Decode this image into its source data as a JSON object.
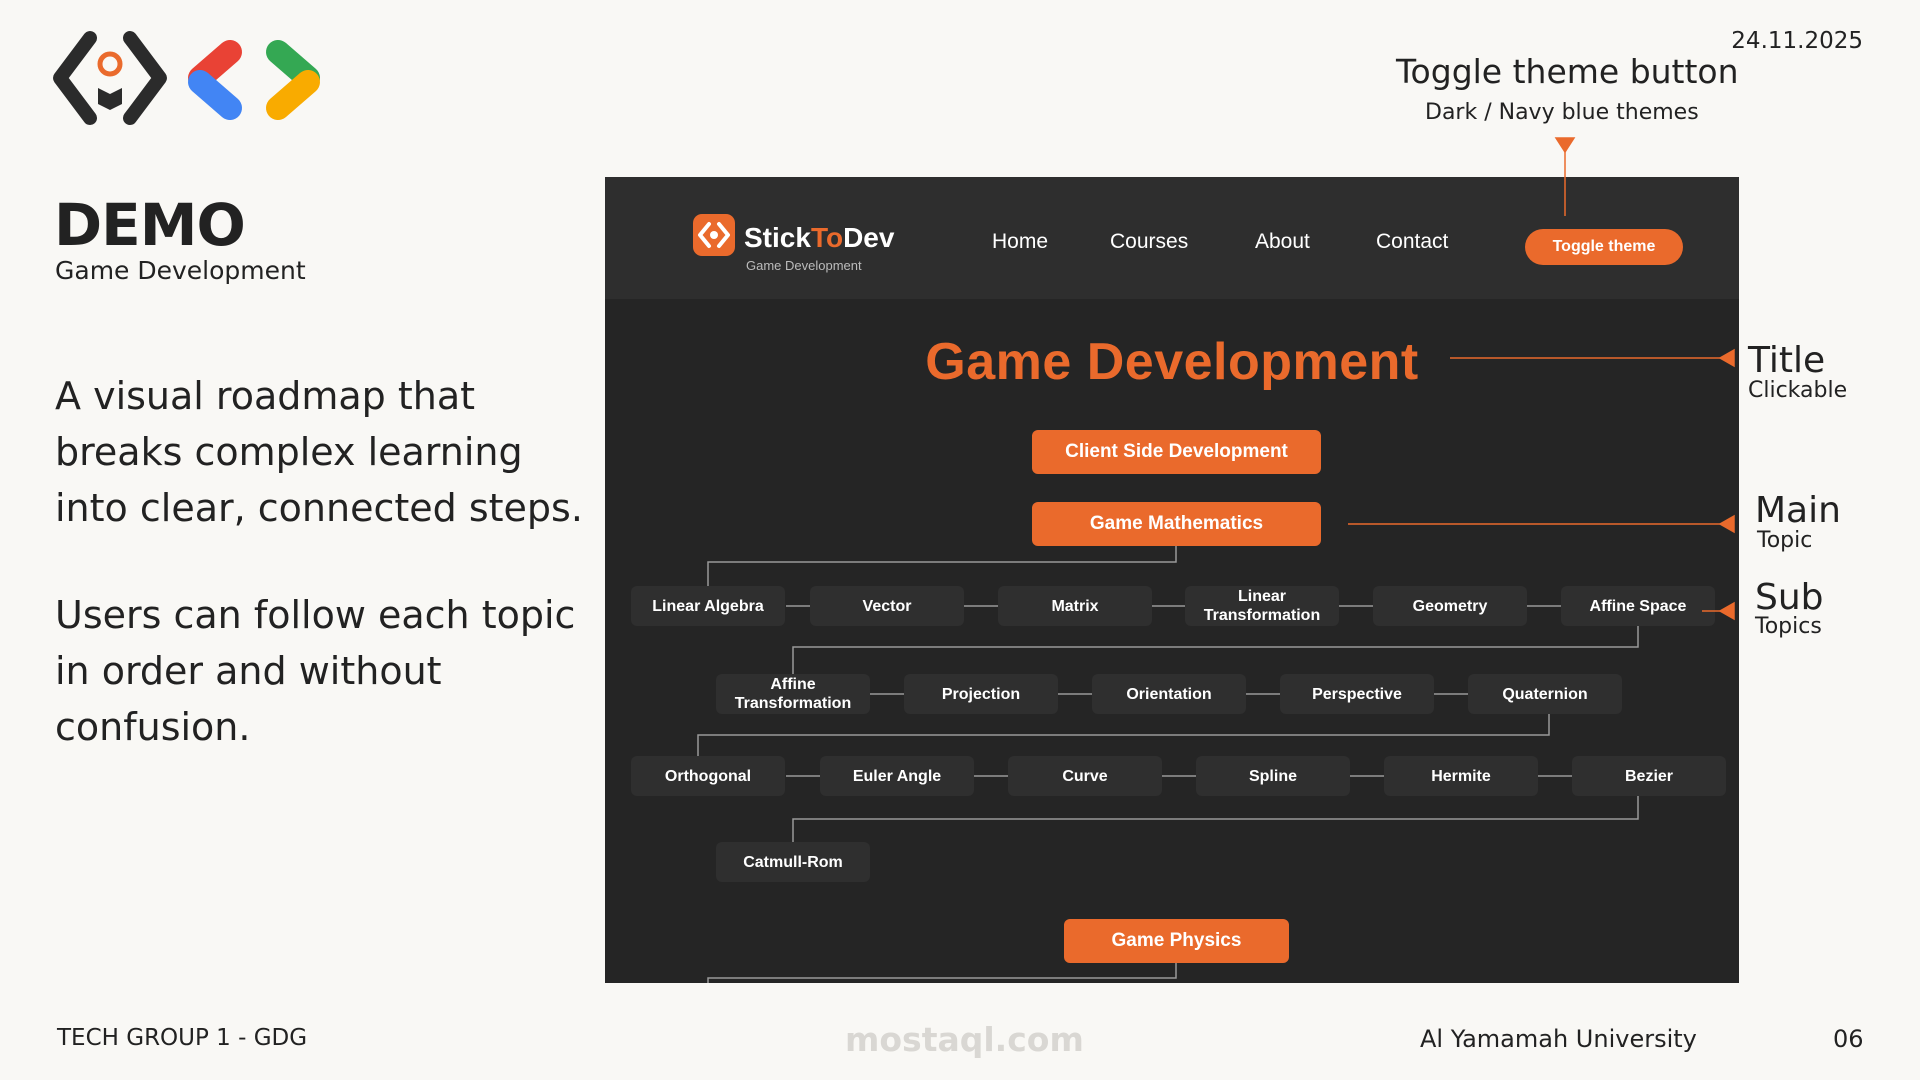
{
  "slide": {
    "date": "24.11.2025",
    "heading": "DEMO",
    "subheading": "Game Development",
    "paragraph1": "A visual roadmap that breaks complex learning into clear, connected steps.",
    "paragraph2": "Users can follow each topic in order and without confusion.",
    "footer_left": "TECH GROUP 1 - GDG",
    "footer_center": "mostaql.com",
    "footer_university": "Al Yamamah University",
    "page_number": "06"
  },
  "annotations": {
    "toggle_title": "Toggle theme button",
    "toggle_sub": "Dark / Navy blue themes",
    "title_title": "Title",
    "title_sub": "Clickable",
    "main_title": "Main",
    "main_sub": "Topic",
    "sub_title": "Sub",
    "sub_sub": "Topics"
  },
  "app": {
    "brand_part1": "Stick",
    "brand_part2": "To",
    "brand_part3": "Dev",
    "brand_tagline": "Game Development",
    "nav": [
      "Home",
      "Courses",
      "About",
      "Contact"
    ],
    "toggle_label": "Toggle theme",
    "roadmap_title": "Game Development",
    "main_topics": [
      "Client Side Development",
      "Game Mathematics",
      "Game Physics"
    ],
    "sub_topics": [
      [
        "Linear Algebra",
        "Vector",
        "Matrix",
        "Linear Transformation",
        "Geometry",
        "Affine Space"
      ],
      [
        "Affine Transformation",
        "Projection",
        "Orientation",
        "Perspective",
        "Quaternion"
      ],
      [
        "Orthogonal",
        "Euler Angle",
        "Curve",
        "Spline",
        "Hermite",
        "Bezier"
      ],
      [
        "Catmull-Rom"
      ]
    ]
  },
  "colors": {
    "accent": "#ea6a2c",
    "background": "#f9f8f5",
    "app_background": "#252525",
    "node_background": "#2f2f2f"
  },
  "icons": [
    "code-brackets-logo-icon",
    "gdg-logo-icon",
    "stick-to-dev-logo-icon"
  ]
}
